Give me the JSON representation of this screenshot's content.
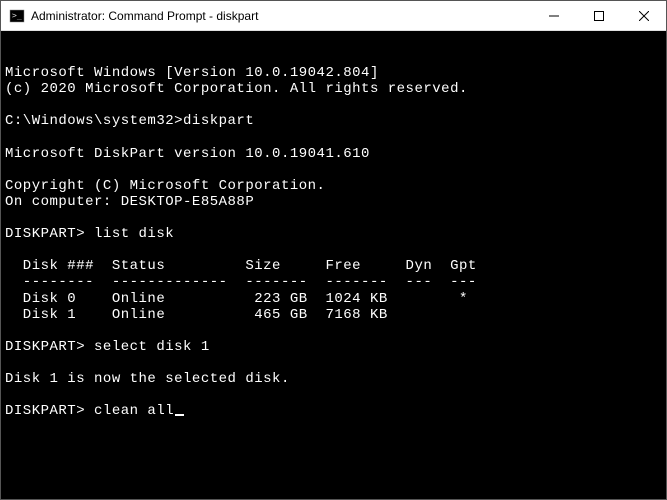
{
  "titlebar": {
    "title": "Administrator: Command Prompt - diskpart"
  },
  "terminal": {
    "lines": [
      "Microsoft Windows [Version 10.0.19042.804]",
      "(c) 2020 Microsoft Corporation. All rights reserved.",
      "",
      "C:\\Windows\\system32>diskpart",
      "",
      "Microsoft DiskPart version 10.0.19041.610",
      "",
      "Copyright (C) Microsoft Corporation.",
      "On computer: DESKTOP-E85A88P",
      "",
      "DISKPART> list disk",
      "",
      "  Disk ###  Status         Size     Free     Dyn  Gpt",
      "  --------  -------------  -------  -------  ---  ---",
      "  Disk 0    Online          223 GB  1024 KB        *",
      "  Disk 1    Online          465 GB  7168 KB",
      "",
      "DISKPART> select disk 1",
      "",
      "Disk 1 is now the selected disk.",
      "",
      "DISKPART> clean all"
    ],
    "has_cursor": true
  }
}
